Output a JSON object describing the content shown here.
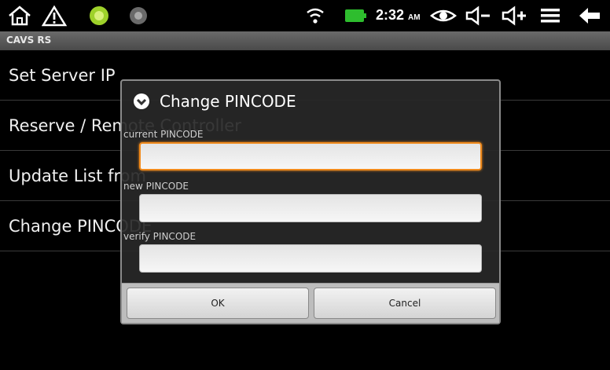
{
  "status_bar": {
    "time": "2:32",
    "ampm": "AM",
    "icons": [
      "home-icon",
      "warning-icon",
      "green-circle-icon",
      "app-icon",
      "wifi-icon",
      "battery-icon",
      "eye-icon",
      "volume-down-icon",
      "volume-up-icon",
      "menu-icon",
      "back-icon"
    ],
    "battery_color": "#2ebd2e"
  },
  "app": {
    "title": "CAVS RS"
  },
  "list": {
    "items": [
      {
        "label": "Set Server IP"
      },
      {
        "label": "Reserve / Remote Controller"
      },
      {
        "label": "Update List from"
      },
      {
        "label": "Change PINCODE"
      }
    ]
  },
  "dialog": {
    "title": "Change PINCODE",
    "fields": [
      {
        "label": "current PINCODE",
        "value": ""
      },
      {
        "label": "new PINCODE",
        "value": ""
      },
      {
        "label": "verify PINCODE",
        "value": ""
      }
    ],
    "ok_label": "OK",
    "cancel_label": "Cancel",
    "focus_color": "#f08a1c"
  }
}
